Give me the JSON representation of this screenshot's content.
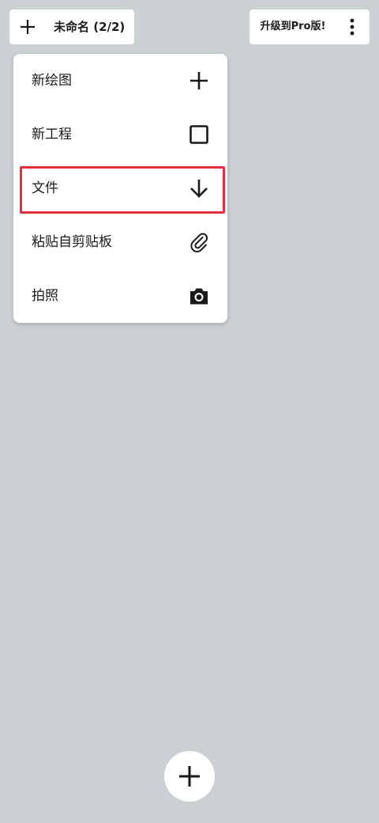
{
  "header": {
    "document_title": "未命名 (2/2)",
    "upgrade_label": "升级到Pro版!"
  },
  "icons": {
    "add": "plus-icon",
    "more": "more-vertical-icon",
    "new_drawing": "plus-icon",
    "new_project": "square-icon",
    "file": "arrow-down-icon",
    "paste": "paperclip-icon",
    "photo": "camera-icon"
  },
  "menu": {
    "items": [
      {
        "label": "新绘图"
      },
      {
        "label": "新工程"
      },
      {
        "label": "文件"
      },
      {
        "label": "粘贴自剪贴板"
      },
      {
        "label": "拍照"
      }
    ],
    "highlighted_index": 2
  },
  "colors": {
    "background": "#cbd0d3",
    "surface": "#ffffff",
    "highlight_border": "#e0323f",
    "text": "#1a1a1a"
  }
}
